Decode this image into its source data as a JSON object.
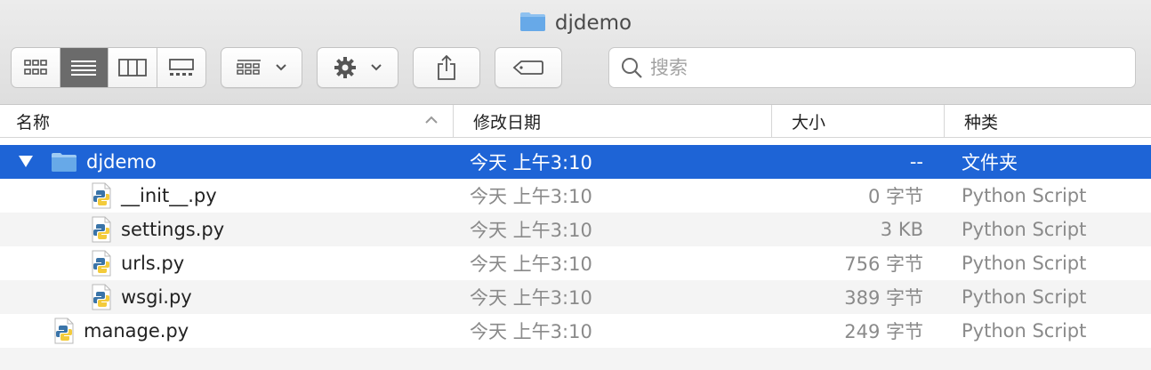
{
  "window": {
    "title": "djdemo"
  },
  "toolbar": {
    "view_modes": [
      "icon-view",
      "list-view",
      "column-view",
      "gallery-view"
    ],
    "active_view": "list-view",
    "search_placeholder": "搜索"
  },
  "columns": {
    "name": "名称",
    "date": "修改日期",
    "size": "大小",
    "kind": "种类"
  },
  "rows": [
    {
      "name": "djdemo",
      "date": "今天 上午3:10",
      "size": "--",
      "kind": "文件夹",
      "icon": "folder-icon",
      "selected": true
    },
    {
      "name": "__init__.py",
      "date": "今天 上午3:10",
      "size": "0 字节",
      "kind": "Python Script",
      "icon": "python-file-icon"
    },
    {
      "name": "settings.py",
      "date": "今天 上午3:10",
      "size": "3 KB",
      "kind": "Python Script",
      "icon": "python-file-icon"
    },
    {
      "name": "urls.py",
      "date": "今天 上午3:10",
      "size": "756 字节",
      "kind": "Python Script",
      "icon": "python-file-icon"
    },
    {
      "name": "wsgi.py",
      "date": "今天 上午3:10",
      "size": "389 字节",
      "kind": "Python Script",
      "icon": "python-file-icon"
    },
    {
      "name": "manage.py",
      "date": "今天 上午3:10",
      "size": "249 字节",
      "kind": "Python Script",
      "icon": "python-file-icon"
    }
  ],
  "colors": {
    "selection": "#1e64d6",
    "folder": "#67a9e8",
    "alt_row": "#f4f4f4"
  }
}
